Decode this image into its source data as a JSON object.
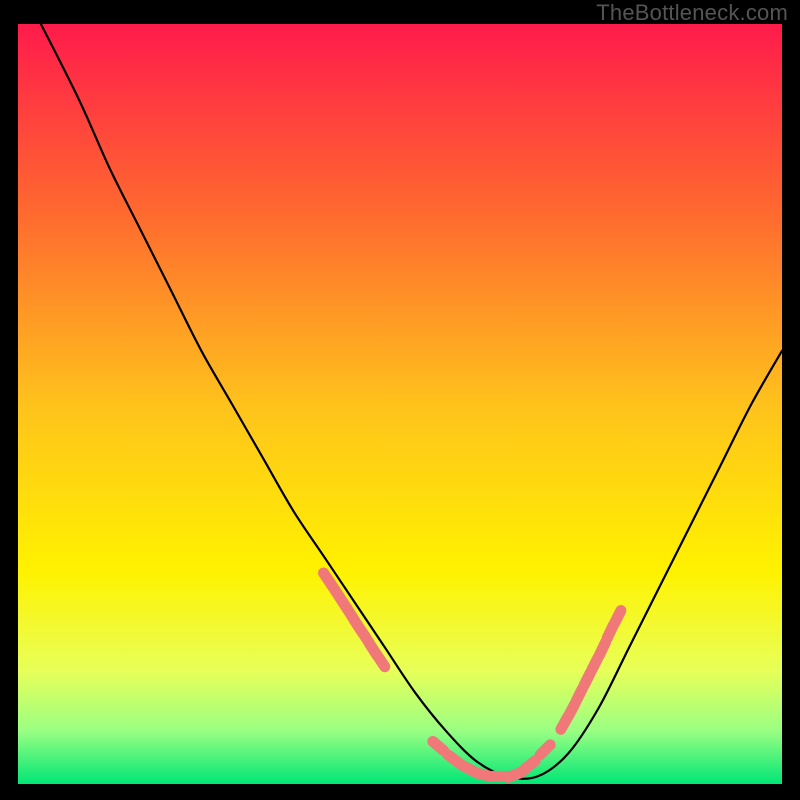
{
  "watermark": "TheBottleneck.com",
  "chart_data": {
    "type": "line",
    "title": "",
    "xlabel": "",
    "ylabel": "",
    "xlim": [
      0,
      100
    ],
    "ylim": [
      0,
      100
    ],
    "grid": false,
    "legend": false,
    "background_gradient_stops": [
      {
        "pos": 0.0,
        "color": "#ff1b4b"
      },
      {
        "pos": 0.25,
        "color": "#ff6a2f"
      },
      {
        "pos": 0.5,
        "color": "#ffc21c"
      },
      {
        "pos": 0.72,
        "color": "#fff200"
      },
      {
        "pos": 0.85,
        "color": "#e8ff58"
      },
      {
        "pos": 0.93,
        "color": "#9aff82"
      },
      {
        "pos": 1.0,
        "color": "#00e676"
      }
    ],
    "curve": {
      "x": [
        3,
        8,
        12,
        16,
        20,
        24,
        28,
        32,
        36,
        40,
        44,
        48,
        52,
        56,
        60,
        64,
        68,
        72,
        76,
        80,
        84,
        88,
        92,
        96,
        100
      ],
      "y": [
        100,
        90,
        81,
        73,
        65,
        57,
        50,
        43,
        36,
        30,
        24,
        18,
        12,
        7,
        3,
        1,
        1,
        4,
        10,
        18,
        26,
        34,
        42,
        50,
        57
      ]
    },
    "marker_clusters": [
      {
        "name": "left-cluster",
        "color": "#f07878",
        "points": [
          {
            "x": 40.5,
            "y": 27.0
          },
          {
            "x": 41.5,
            "y": 25.5
          },
          {
            "x": 42.6,
            "y": 23.8
          },
          {
            "x": 43.5,
            "y": 22.4
          },
          {
            "x": 44.5,
            "y": 20.8
          },
          {
            "x": 45.5,
            "y": 19.3
          },
          {
            "x": 46.5,
            "y": 17.7
          },
          {
            "x": 47.5,
            "y": 16.2
          }
        ]
      },
      {
        "name": "bottom-cluster",
        "color": "#f07878",
        "points": [
          {
            "x": 55.0,
            "y": 5.0
          },
          {
            "x": 57.0,
            "y": 3.3
          },
          {
            "x": 59.0,
            "y": 2.0
          },
          {
            "x": 61.0,
            "y": 1.2
          },
          {
            "x": 63.0,
            "y": 1.0
          },
          {
            "x": 65.0,
            "y": 1.2
          },
          {
            "x": 67.0,
            "y": 2.5
          },
          {
            "x": 69.0,
            "y": 4.5
          }
        ]
      },
      {
        "name": "right-cluster",
        "color": "#f07878",
        "points": [
          {
            "x": 71.5,
            "y": 8.0
          },
          {
            "x": 72.5,
            "y": 9.8
          },
          {
            "x": 73.5,
            "y": 11.8
          },
          {
            "x": 74.5,
            "y": 13.8
          },
          {
            "x": 75.5,
            "y": 15.8
          },
          {
            "x": 76.5,
            "y": 17.8
          },
          {
            "x": 77.5,
            "y": 20.0
          },
          {
            "x": 78.5,
            "y": 22.0
          }
        ]
      }
    ]
  }
}
